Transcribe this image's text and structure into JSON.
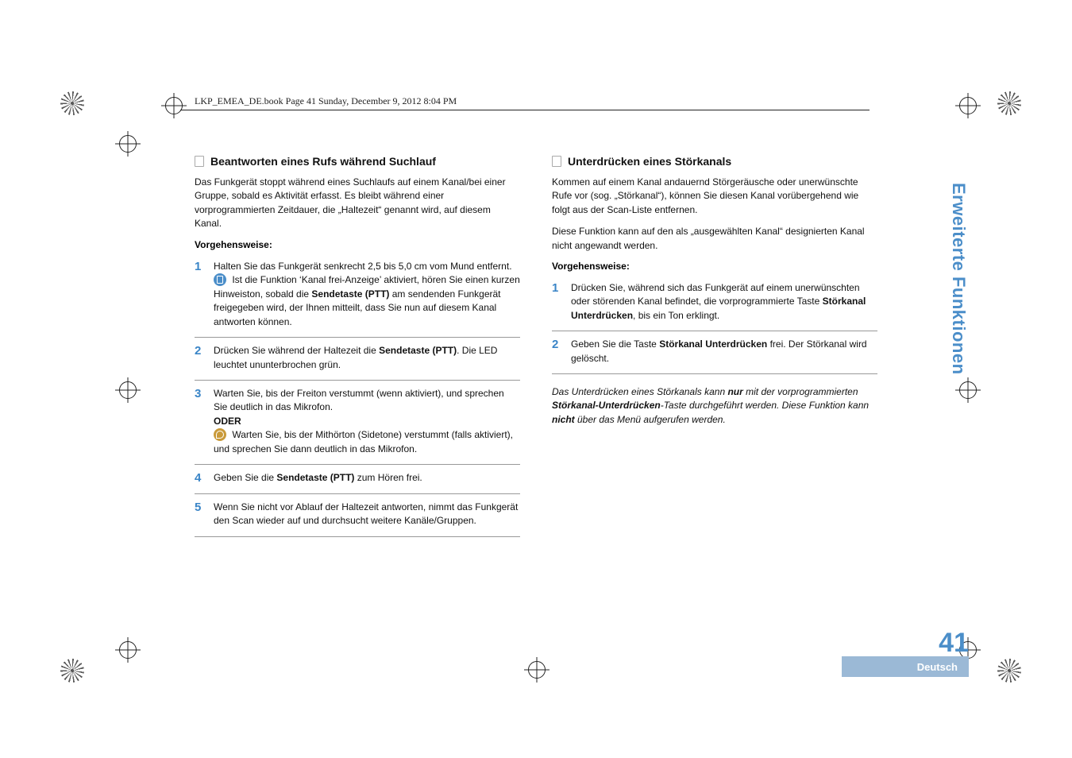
{
  "meta": {
    "header": "LKP_EMEA_DE.book  Page 41  Sunday, December 9, 2012  8:04 PM",
    "side_tab": "Erweiterte Funktionen",
    "page_number": "41",
    "language": "Deutsch"
  },
  "left": {
    "heading": "Beantworten eines Rufs während Suchlauf",
    "intro": "Das Funkgerät stoppt während eines Suchlaufs auf einem Kanal/bei einer Gruppe, sobald es Aktivität erfasst. Es bleibt während einer vorprogrammierten Zeitdauer, die „Haltezeit“ genannt wird, auf diesem Kanal.",
    "proc_label": "Vorgehensweise:",
    "steps": [
      {
        "num": "1",
        "pre": "Halten Sie das Funkgerät senkrecht 2,5 bis 5,0 cm vom Mund entfernt.",
        "icon_text_before": "Ist die Funktion ‘Kanal frei-Anzeige’ aktiviert, hören Sie einen kurzen Hinweiston, sobald die ",
        "bold1": "Sendetaste (PTT)",
        "after1": " am sendenden Funkgerät freigegeben wird, der Ihnen mitteilt, dass Sie nun auf diesem Kanal antworten können."
      },
      {
        "num": "2",
        "text_before": "Drücken Sie während der Haltezeit die ",
        "bold1": "Sendetaste (PTT)",
        "after1": ". Die LED leuchtet ununterbrochen grün."
      },
      {
        "num": "3",
        "text_before": "Warten Sie, bis der Freiton verstummt (wenn aktiviert), und sprechen Sie deutlich in das Mikrofon.",
        "oder": "ODER",
        "icon_text": "Warten Sie, bis der Mithörton (Sidetone) verstummt (falls aktiviert), und sprechen Sie dann deutlich in das Mikrofon."
      },
      {
        "num": "4",
        "text_before": "Geben Sie die ",
        "bold1": "Sendetaste (PTT)",
        "after1": " zum Hören frei."
      },
      {
        "num": "5",
        "text": "Wenn Sie nicht vor Ablauf der Haltezeit antworten, nimmt das Funkgerät den Scan wieder auf und durchsucht weitere Kanäle/Gruppen."
      }
    ]
  },
  "right": {
    "heading": "Unterdrücken eines Störkanals",
    "intro1": "Kommen auf einem Kanal andauernd Störgeräusche oder unerwünschte Rufe vor (sog. „Störkanal“), können Sie diesen Kanal vorübergehend wie folgt aus der Scan-Liste entfernen.",
    "intro2": "Diese Funktion kann auf den als „ausgewählten Kanal“ designierten Kanal nicht angewandt werden.",
    "proc_label": "Vorgehensweise:",
    "steps": [
      {
        "num": "1",
        "text_before": "Drücken Sie, während sich das Funkgerät auf einem unerwünschten oder störenden Kanal befindet, die vorprogrammierte Taste ",
        "bold1": "Störkanal Unterdrücken",
        "after1": ", bis ein Ton erklingt."
      },
      {
        "num": "2",
        "text_before": "Geben Sie die Taste ",
        "bold1": "Störkanal Unterdrücken",
        "after1": " frei. Der Störkanal wird gelöscht."
      }
    ],
    "note": {
      "t1": "Das Unterdrücken eines Störkanals kann ",
      "b1": "nur",
      "t2": " mit der vorprogrammierten ",
      "b2": "Störkanal-Unterdrücken",
      "t3": "-Taste durchgeführt werden. Diese Funktion kann ",
      "b3": "nicht",
      "t4": " über das Menü aufgerufen werden."
    }
  }
}
